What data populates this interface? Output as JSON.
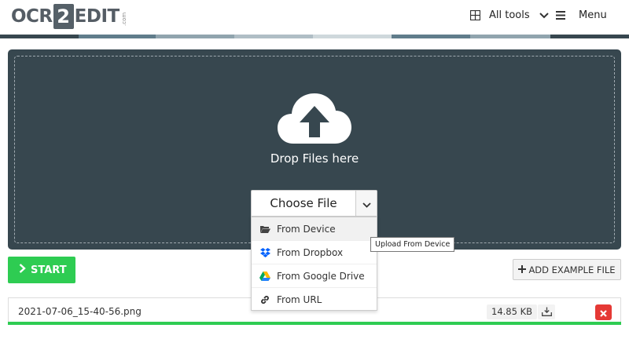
{
  "brand": {
    "logo_left": "OCR",
    "logo_num": "2",
    "logo_right": "EDIT",
    "logo_suffix": ".com"
  },
  "nav": {
    "all_tools": "All tools",
    "menu": "Menu"
  },
  "colors": {
    "stripe": [
      "#37474f",
      "#607d8b",
      "#90a4ae",
      "#b0bec5",
      "#cfd8dc",
      "#607d8b",
      "#90a4ae",
      "#37474f"
    ],
    "primary": "#2ecc52",
    "danger": "#e53935",
    "dropzone": "#37474f"
  },
  "dropzone": {
    "text": "Drop Files here",
    "icon": "cloud-upload-icon"
  },
  "choose_file": {
    "label": "Choose File",
    "menu": [
      {
        "label": "From Device",
        "icon": "folder-open-icon"
      },
      {
        "label": "From Dropbox",
        "icon": "dropbox-icon"
      },
      {
        "label": "From Google Drive",
        "icon": "google-drive-icon"
      },
      {
        "label": "From URL",
        "icon": "link-icon"
      }
    ]
  },
  "tooltip": "Upload From Device",
  "actions": {
    "start": "START",
    "add_example": "ADD EXAMPLE FILE"
  },
  "file": {
    "name": "2021-07-06_15-40-56.png",
    "size": "14.85 KB",
    "progress": 1.0
  }
}
